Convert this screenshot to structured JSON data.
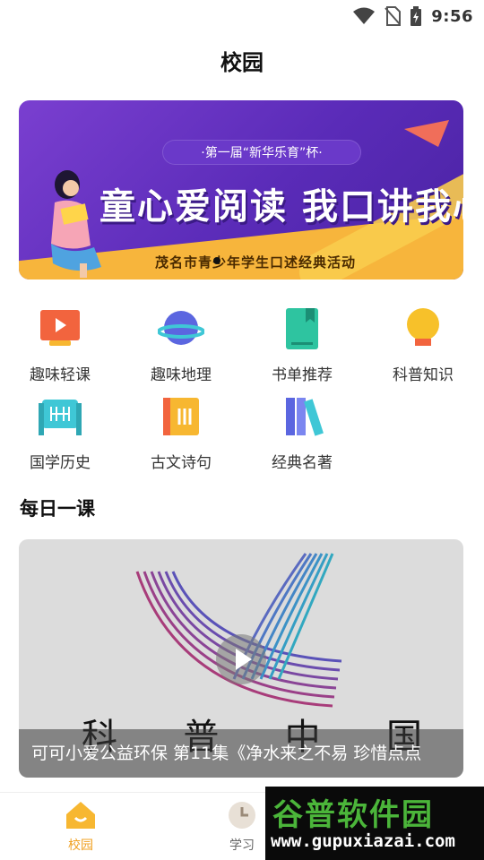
{
  "status_bar": {
    "time": "9:56",
    "icons": [
      "wifi-icon",
      "no-sim-icon",
      "battery-charging-icon"
    ]
  },
  "header": {
    "title": "校园"
  },
  "banner": {
    "tag": "·第一届“新华乐育”杯·",
    "headline": "童心爱阅读 我口讲我心",
    "subtitle": "茂名市青少年学生口述经典活动"
  },
  "categories": [
    {
      "label": "趣味轻课",
      "icon": "video-lesson-icon"
    },
    {
      "label": "趣味地理",
      "icon": "planet-icon"
    },
    {
      "label": "书单推荐",
      "icon": "bookmark-book-icon"
    },
    {
      "label": "科普知识",
      "icon": "lightbulb-icon"
    },
    {
      "label": "国学历史",
      "icon": "scroll-icon"
    },
    {
      "label": "古文诗句",
      "icon": "ancient-book-icon"
    },
    {
      "label": "经典名著",
      "icon": "books-shelf-icon"
    }
  ],
  "daily_lesson": {
    "section_title": "每日一课",
    "logo_text": [
      "科",
      "普",
      "中",
      "国"
    ],
    "caption": "可可小爱公益环保 第11集《净水来之不易 珍惜点点"
  },
  "bottom_nav": [
    {
      "label": "校园",
      "icon": "home-icon",
      "active": true
    },
    {
      "label": "学习",
      "icon": "clock-icon",
      "active": false
    }
  ],
  "watermark": {
    "title": "谷普软件园",
    "url": "www.gupuxiazai.com"
  },
  "colors": {
    "accent": "#f0a020",
    "banner_purple": "#5a2bb8",
    "watermark_green": "#4bb53a"
  }
}
